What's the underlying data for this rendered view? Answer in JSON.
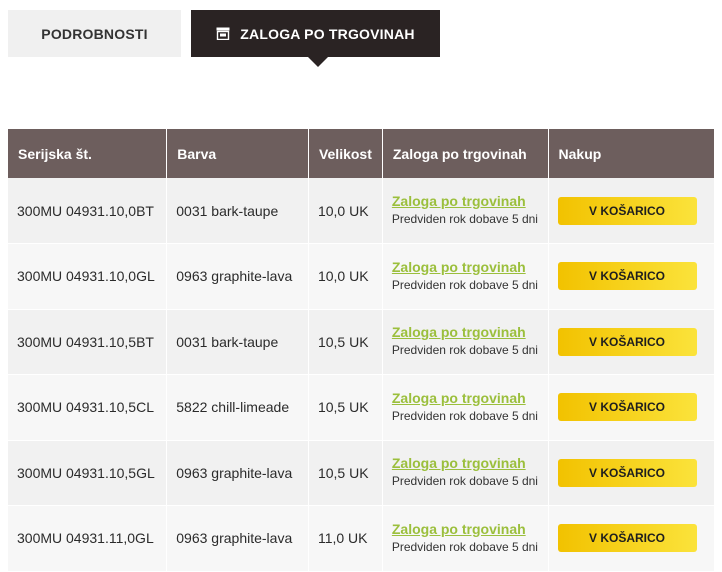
{
  "tabs": {
    "details_label": "PODROBNOSTI",
    "stock_label": "ZALOGA PO TRGOVINAH",
    "stock_icon": "store-icon"
  },
  "table": {
    "headers": {
      "serial": "Serijska št.",
      "color": "Barva",
      "size": "Velikost",
      "store": "Zaloga po trgovinah",
      "buy": "Nakup"
    },
    "rows": [
      {
        "serial": "300MU 04931.10,0BT",
        "color": "0031 bark-taupe",
        "size": "10,0 UK",
        "store_link": "Zaloga po trgovinah",
        "delivery": "Predviden rok dobave 5 dni",
        "buy_label": "V KOŠARICO"
      },
      {
        "serial": "300MU 04931.10,0GL",
        "color": "0963 graphite-lava",
        "size": "10,0 UK",
        "store_link": "Zaloga po trgovinah",
        "delivery": "Predviden rok dobave 5 dni",
        "buy_label": "V KOŠARICO"
      },
      {
        "serial": "300MU 04931.10,5BT",
        "color": "0031 bark-taupe",
        "size": "10,5 UK",
        "store_link": "Zaloga po trgovinah",
        "delivery": "Predviden rok dobave 5 dni",
        "buy_label": "V KOŠARICO"
      },
      {
        "serial": "300MU 04931.10,5CL",
        "color": "5822 chill-limeade",
        "size": "10,5 UK",
        "store_link": "Zaloga po trgovinah",
        "delivery": "Predviden rok dobave 5 dni",
        "buy_label": "V KOŠARICO"
      },
      {
        "serial": "300MU 04931.10,5GL",
        "color": "0963 graphite-lava",
        "size": "10,5 UK",
        "store_link": "Zaloga po trgovinah",
        "delivery": "Predviden rok dobave 5 dni",
        "buy_label": "V KOŠARICO"
      },
      {
        "serial": "300MU 04931.11,0GL",
        "color": "0963 graphite-lava",
        "size": "11,0 UK",
        "store_link": "Zaloga po trgovinah",
        "delivery": "Predviden rok dobave 5 dni",
        "buy_label": "V KOŠARICO"
      }
    ]
  },
  "colors": {
    "header_bg": "#6d5e5d",
    "active_tab_bg": "#2a2323",
    "link_green": "#9bbf3c",
    "button_yellow": "#f2c200"
  }
}
